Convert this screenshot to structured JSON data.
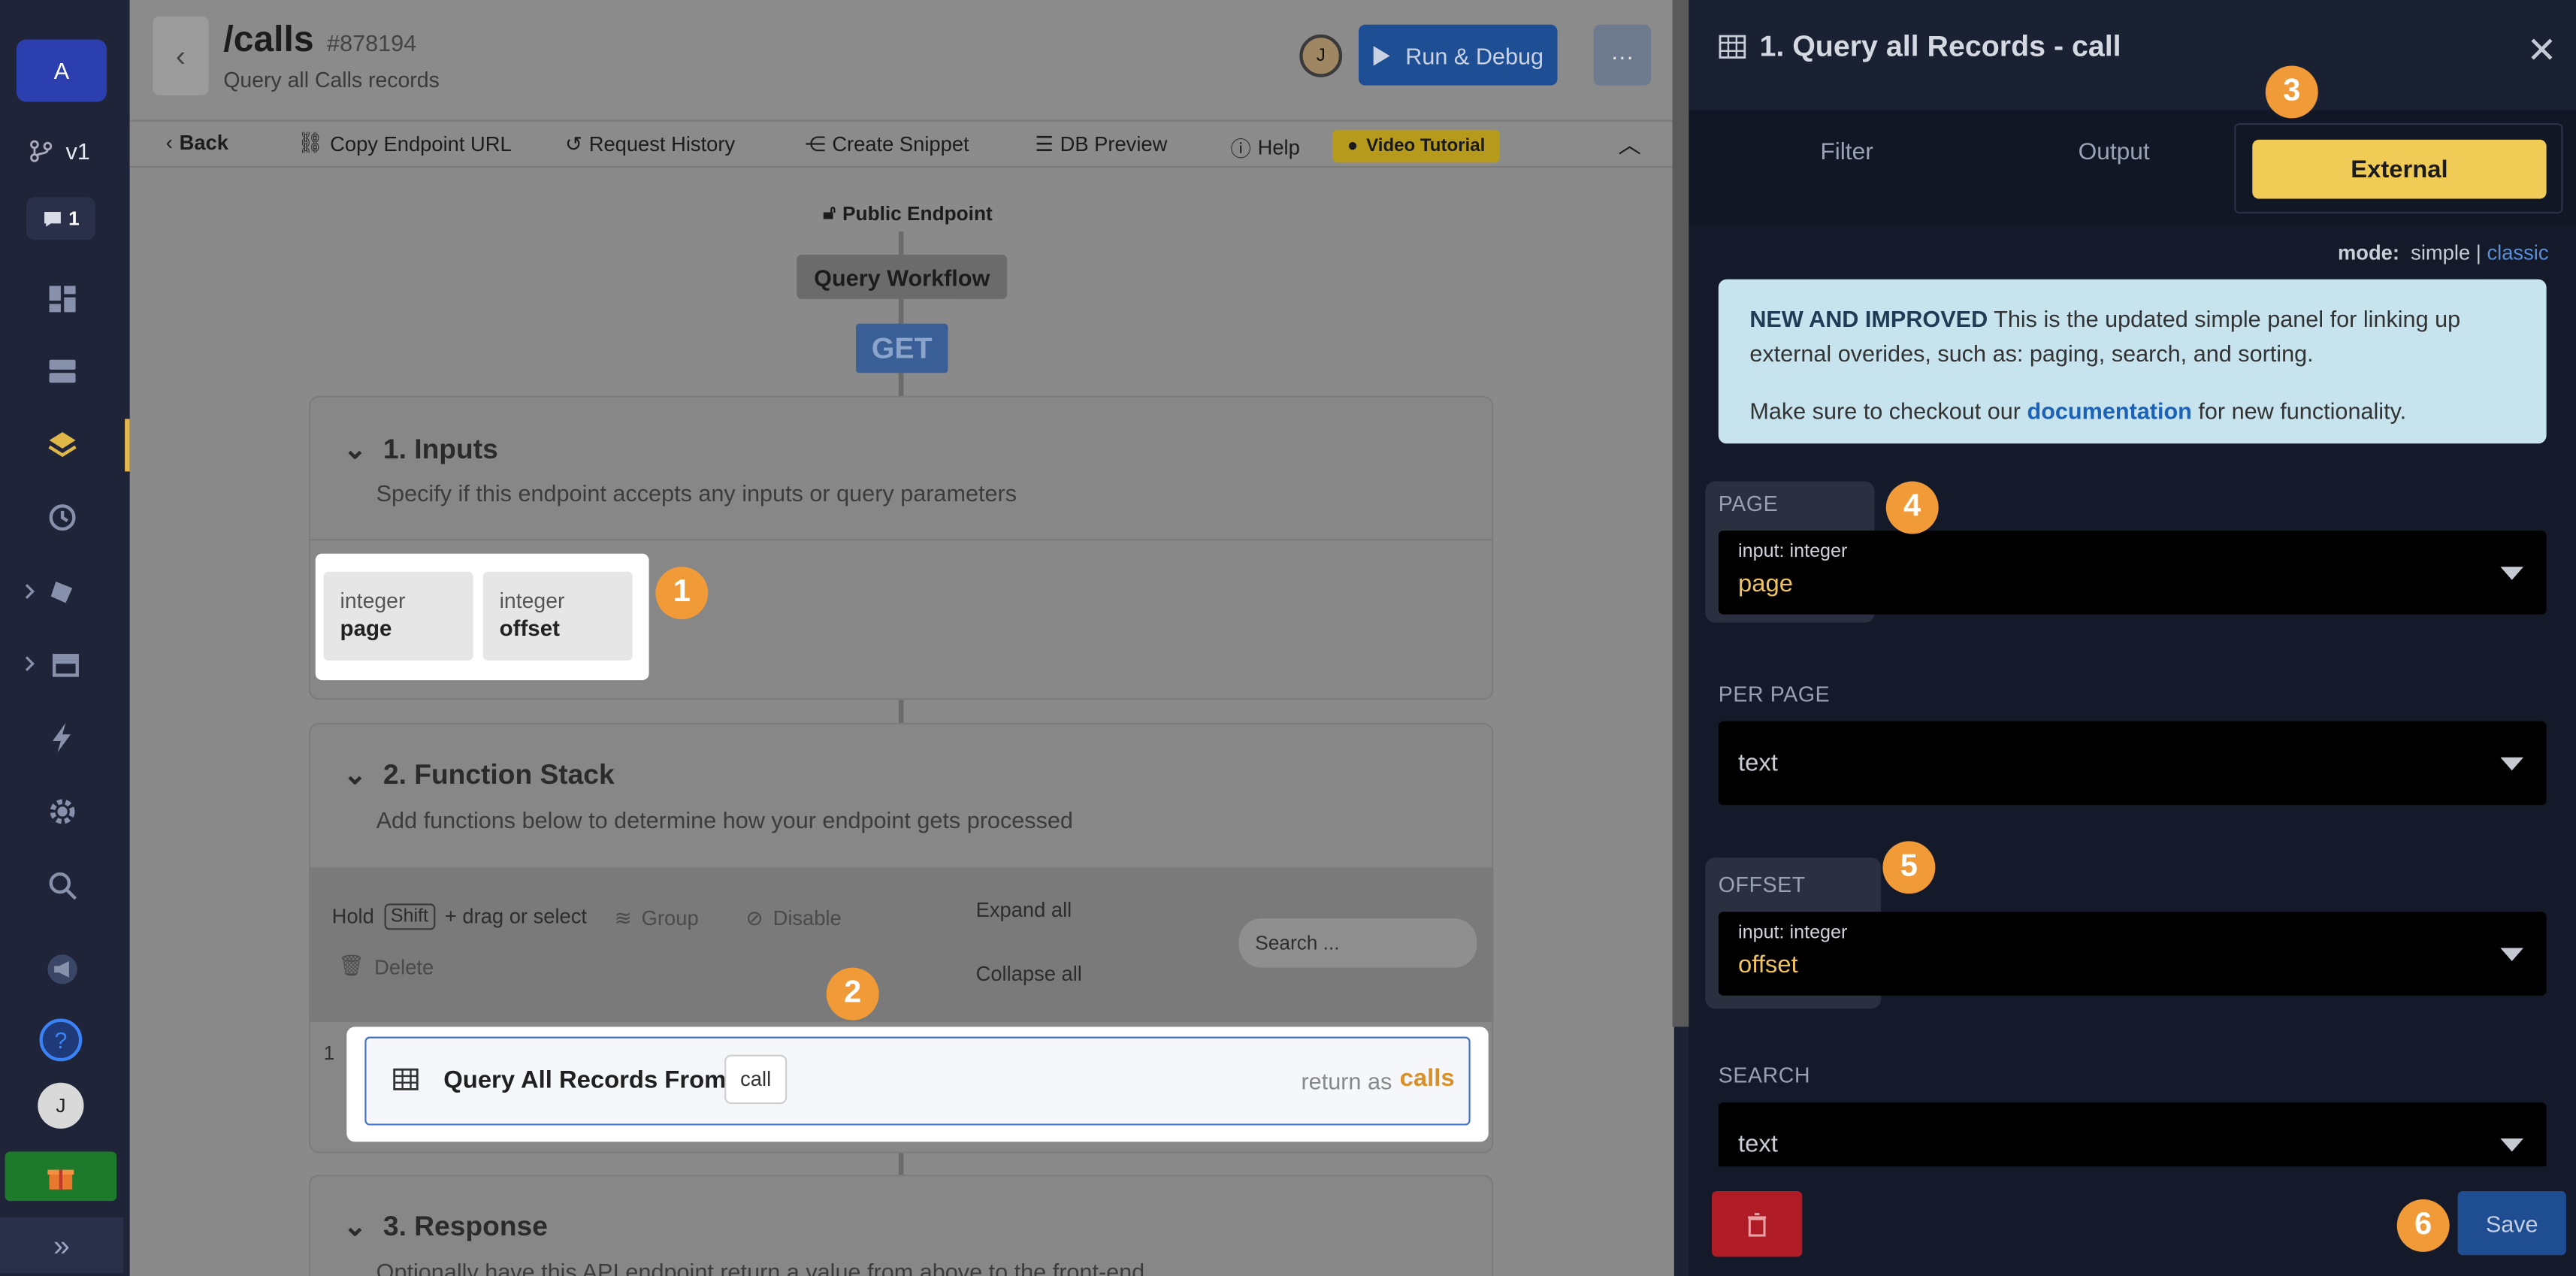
{
  "rail": {
    "workspace_initial": "A",
    "branch_label": "v1",
    "comments_count": "1",
    "user_initial": "J"
  },
  "header": {
    "title": "/calls",
    "id": "#878194",
    "subtitle": "Query all Calls records",
    "avatar_initial": "J",
    "run_label": "Run & Debug",
    "more_label": "···"
  },
  "toolbar": {
    "back": "Back",
    "copy_url": "Copy Endpoint URL",
    "history": "Request History",
    "snippet": "Create Snippet",
    "db_preview": "DB Preview",
    "help": "Help",
    "video": "Video Tutorial"
  },
  "canvas": {
    "public_endpoint": "Public Endpoint",
    "workflow_label": "Query Workflow",
    "method": "GET",
    "inputs": {
      "title": "1. Inputs",
      "subtitle": "Specify if this endpoint accepts any inputs or query parameters",
      "items": [
        {
          "type": "integer",
          "name": "page"
        },
        {
          "type": "integer",
          "name": "offset"
        }
      ]
    },
    "stack": {
      "title": "2. Function Stack",
      "subtitle": "Add functions below to determine how your endpoint gets processed",
      "hold": "Hold",
      "shift": "Shift",
      "drag": "+ drag or select",
      "group": "Group",
      "disable": "Disable",
      "delete": "Delete",
      "expand": "Expand all",
      "collapse": "Collapse all",
      "search_placeholder": "Search ...",
      "row_number": "1",
      "query_label": "Query All Records From",
      "table_chip": "call",
      "return_as": "return as",
      "return_var": "calls"
    },
    "response": {
      "title": "3. Response",
      "subtitle": "Optionally have this API endpoint return a value from above to the front-end"
    }
  },
  "badges": [
    "1",
    "2",
    "3",
    "4",
    "5",
    "6"
  ],
  "panel": {
    "title": "1. Query all Records - call",
    "close": "✕",
    "tabs": {
      "filter": "Filter",
      "output": "Output",
      "external": "External"
    },
    "mode_label": "mode:",
    "mode_simple": "simple",
    "mode_sep": "|",
    "mode_classic": "classic",
    "notice_bold": "NEW AND IMPROVED",
    "notice_text": " This is the updated simple panel for linking up external overides, such as: paging, search, and sorting.",
    "notice_2a": "Make sure to checkout our ",
    "notice_link": "documentation",
    "notice_2b": " for new functionality.",
    "fields": {
      "page_label": "PAGE",
      "page_hint": "input: integer",
      "page_value": "page",
      "per_page_label": "PER PAGE",
      "per_page_value": "text",
      "offset_label": "OFFSET",
      "offset_hint": "input: integer",
      "offset_value": "offset",
      "search_label": "SEARCH",
      "search_value": "text"
    },
    "save": "Save"
  }
}
